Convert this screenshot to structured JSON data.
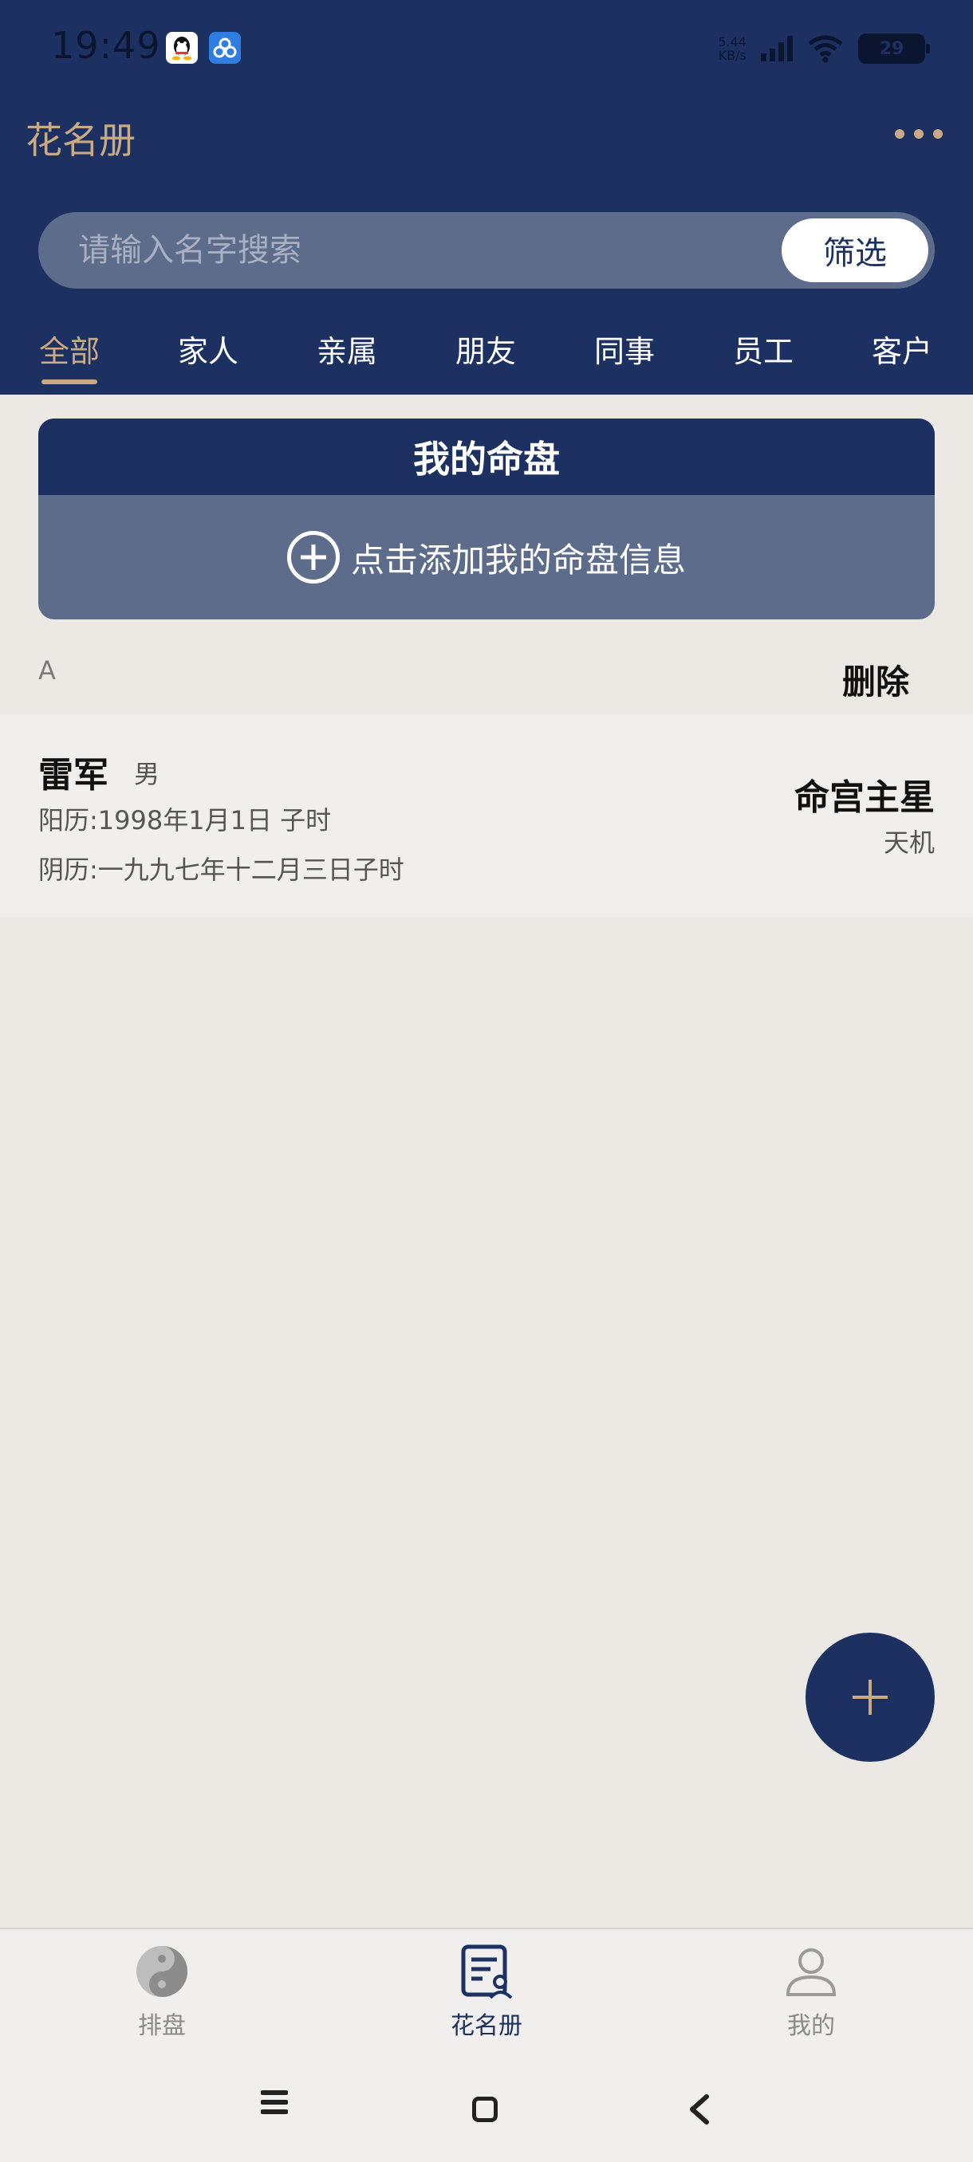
{
  "status_bar": {
    "time": "19:49",
    "net_speed_value": "5.44",
    "net_speed_unit": "KB/s",
    "battery": "29"
  },
  "header": {
    "title": "花名册"
  },
  "search": {
    "placeholder": "请输入名字搜索",
    "filter_label": "筛选"
  },
  "tabs": [
    {
      "label": "全部",
      "active": true
    },
    {
      "label": "家人"
    },
    {
      "label": "亲属"
    },
    {
      "label": "朋友"
    },
    {
      "label": "同事"
    },
    {
      "label": "员工"
    },
    {
      "label": "客户"
    }
  ],
  "my_chart": {
    "title": "我的命盘",
    "add_label": "点击添加我的命盘信息"
  },
  "list": {
    "section_letter": "A",
    "delete_label": "删除",
    "contacts": [
      {
        "name": "雷军",
        "gender": "男",
        "solar": "阳历:1998年1月1日 子时",
        "lunar": "阴历:一九九七年十二月三日子时",
        "star_title": "命宫主星",
        "star_value": "天机"
      }
    ]
  },
  "bottom_nav": [
    {
      "label": "排盘",
      "icon": "yin-yang-icon"
    },
    {
      "label": "花名册",
      "icon": "roster-icon",
      "active": true
    },
    {
      "label": "我的",
      "icon": "user-icon"
    }
  ],
  "colors": {
    "primary": "#1c3162",
    "accent": "#c9aa84",
    "background": "#ece8e4"
  }
}
